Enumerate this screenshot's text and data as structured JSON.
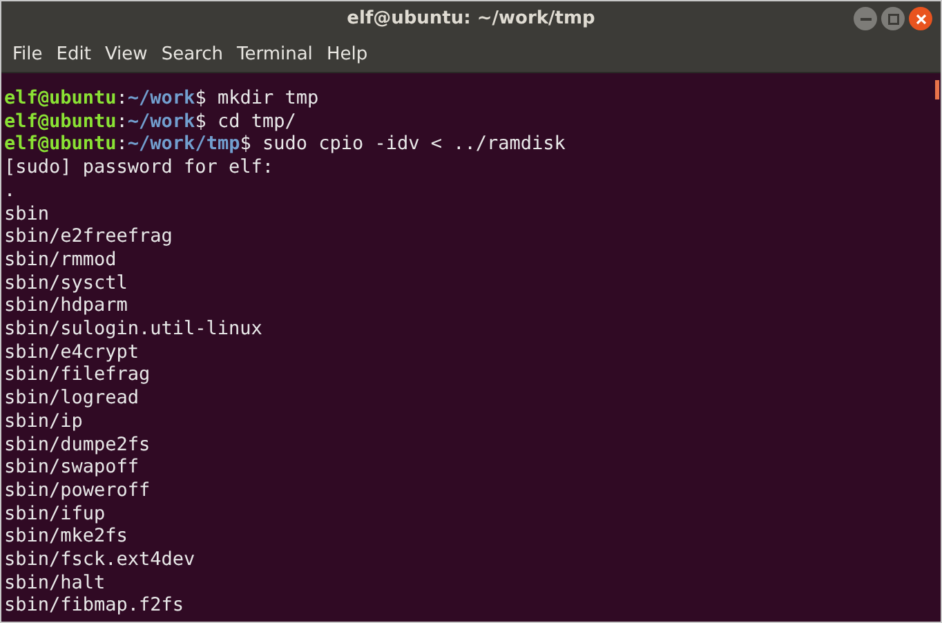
{
  "window": {
    "title": "elf@ubuntu: ~/work/tmp"
  },
  "menu": [
    "File",
    "Edit",
    "View",
    "Search",
    "Terminal",
    "Help"
  ],
  "terminal": {
    "lines": [
      {
        "kind": "prompt",
        "user": "elf@ubuntu",
        "separator": ":",
        "path": "~/work",
        "symbol": "$",
        "command": "mkdir tmp"
      },
      {
        "kind": "prompt",
        "user": "elf@ubuntu",
        "separator": ":",
        "path": "~/work",
        "symbol": "$",
        "command": "cd tmp/"
      },
      {
        "kind": "prompt",
        "user": "elf@ubuntu",
        "separator": ":",
        "path": "~/work/tmp",
        "symbol": "$",
        "command": "sudo cpio -idv < ../ramdisk"
      },
      {
        "kind": "output",
        "text": "[sudo] password for elf:"
      },
      {
        "kind": "output",
        "text": "."
      },
      {
        "kind": "output",
        "text": "sbin"
      },
      {
        "kind": "output",
        "text": "sbin/e2freefrag"
      },
      {
        "kind": "output",
        "text": "sbin/rmmod"
      },
      {
        "kind": "output",
        "text": "sbin/sysctl"
      },
      {
        "kind": "output",
        "text": "sbin/hdparm"
      },
      {
        "kind": "output",
        "text": "sbin/sulogin.util-linux"
      },
      {
        "kind": "output",
        "text": "sbin/e4crypt"
      },
      {
        "kind": "output",
        "text": "sbin/filefrag"
      },
      {
        "kind": "output",
        "text": "sbin/logread"
      },
      {
        "kind": "output",
        "text": "sbin/ip"
      },
      {
        "kind": "output",
        "text": "sbin/dumpe2fs"
      },
      {
        "kind": "output",
        "text": "sbin/swapoff"
      },
      {
        "kind": "output",
        "text": "sbin/poweroff"
      },
      {
        "kind": "output",
        "text": "sbin/ifup"
      },
      {
        "kind": "output",
        "text": "sbin/mke2fs"
      },
      {
        "kind": "output",
        "text": "sbin/fsck.ext4dev"
      },
      {
        "kind": "output",
        "text": "sbin/halt"
      },
      {
        "kind": "output",
        "text": "sbin/fibmap.f2fs"
      }
    ]
  }
}
